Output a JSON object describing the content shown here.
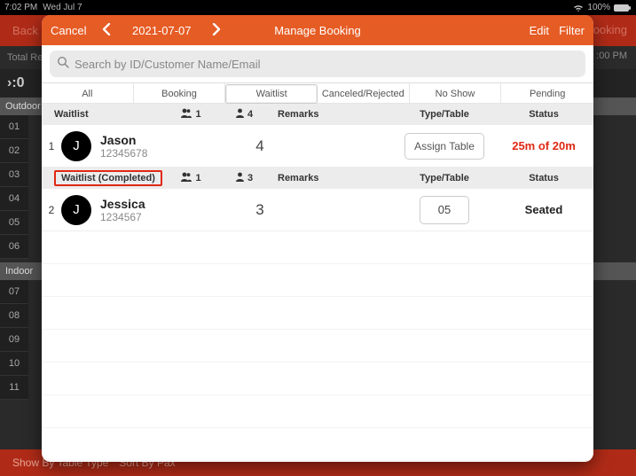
{
  "statusbar": {
    "time": "7:02 PM",
    "date": "Wed Jul 7",
    "battery": "100%"
  },
  "bg": {
    "back": "Back",
    "booking": "ooking",
    "totalRes": "Total Re",
    "rightTime": ":00 PM",
    "clock": "›:0",
    "outdoor": "Outdoor",
    "indoor": "Indoor",
    "hours": [
      "01",
      "02",
      "03",
      "04",
      "05",
      "06",
      "07",
      "08",
      "09",
      "10",
      "11"
    ],
    "showBy": "Show By Table Type",
    "sortBy": "Sort By Pax"
  },
  "modal": {
    "cancel": "Cancel",
    "date": "2021-07-07",
    "title": "Manage Booking",
    "edit": "Edit",
    "filter": "Filter",
    "search": {
      "placeholder": "Search by ID/Customer Name/Email"
    },
    "tabs": {
      "all": "All",
      "booking": "Booking",
      "waitlist": "Waitlist",
      "canceled": "Canceled/Rejected",
      "noshow": "No Show",
      "pending": "Pending"
    },
    "section1": {
      "title": "Waitlist",
      "groups": "1",
      "people": "4",
      "remarks": "Remarks",
      "type": "Type/Table",
      "status": "Status"
    },
    "row1": {
      "num": "1",
      "avatar": "J",
      "name": "Jason",
      "id": "12345678",
      "pax": "4",
      "assign": "Assign Table",
      "status": "25m of 20m"
    },
    "section2": {
      "title": "Waitlist (Completed)",
      "groups": "1",
      "people": "3",
      "remarks": "Remarks",
      "type": "Type/Table",
      "status": "Status"
    },
    "row2": {
      "num": "2",
      "avatar": "J",
      "name": "Jessica",
      "id": "1234567",
      "pax": "3",
      "table": "05",
      "status": "Seated"
    }
  }
}
